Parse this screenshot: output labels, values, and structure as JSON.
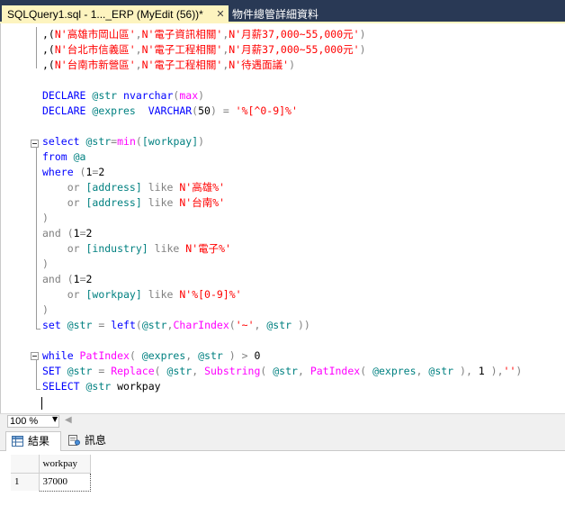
{
  "tabs": {
    "active_label": "SQLQuery1.sql - 1..._ERP (MyEdit (56))*",
    "close_glyph": "✕",
    "inactive_label": "物件總管詳細資料"
  },
  "code_lines": [
    [
      {
        "t": ",(",
        "c": "txt"
      },
      {
        "t": "N'高雄市岡山區'",
        "c": "str"
      },
      {
        "t": ",",
        "c": "op"
      },
      {
        "t": "N'電子資訊相關'",
        "c": "str"
      },
      {
        "t": ",",
        "c": "op"
      },
      {
        "t": "N'月薪37,000~55,000元'",
        "c": "str"
      },
      {
        "t": ")",
        "c": "op"
      }
    ],
    [
      {
        "t": ",(",
        "c": "txt"
      },
      {
        "t": "N'台北市信義區'",
        "c": "str"
      },
      {
        "t": ",",
        "c": "op"
      },
      {
        "t": "N'電子工程相關'",
        "c": "str"
      },
      {
        "t": ",",
        "c": "op"
      },
      {
        "t": "N'月薪37,000~55,000元'",
        "c": "str"
      },
      {
        "t": ")",
        "c": "op"
      }
    ],
    [
      {
        "t": ",(",
        "c": "txt"
      },
      {
        "t": "N'台南市新營區'",
        "c": "str"
      },
      {
        "t": ",",
        "c": "op"
      },
      {
        "t": "N'電子工程相關'",
        "c": "str"
      },
      {
        "t": ",",
        "c": "op"
      },
      {
        "t": "N'待遇面議'",
        "c": "str"
      },
      {
        "t": ")",
        "c": "op"
      }
    ],
    [],
    [
      {
        "t": "DECLARE ",
        "c": "kw"
      },
      {
        "t": "@str ",
        "c": "ident"
      },
      {
        "t": "nvarchar",
        "c": "kw"
      },
      {
        "t": "(",
        "c": "op"
      },
      {
        "t": "max",
        "c": "fn"
      },
      {
        "t": ")",
        "c": "op"
      }
    ],
    [
      {
        "t": "DECLARE ",
        "c": "kw"
      },
      {
        "t": "@expres  ",
        "c": "ident"
      },
      {
        "t": "VARCHAR",
        "c": "kw"
      },
      {
        "t": "(",
        "c": "op"
      },
      {
        "t": "50",
        "c": "txt"
      },
      {
        "t": ") = ",
        "c": "op"
      },
      {
        "t": "'%[^0-9]%'",
        "c": "str"
      }
    ],
    [],
    [
      {
        "t": "select ",
        "c": "kw"
      },
      {
        "t": "@str",
        "c": "ident"
      },
      {
        "t": "=",
        "c": "op"
      },
      {
        "t": "min",
        "c": "fn"
      },
      {
        "t": "(",
        "c": "op"
      },
      {
        "t": "[workpay]",
        "c": "ident"
      },
      {
        "t": ")",
        "c": "op"
      }
    ],
    [
      {
        "t": "from ",
        "c": "kw"
      },
      {
        "t": "@a",
        "c": "ident"
      }
    ],
    [
      {
        "t": "where ",
        "c": "kw"
      },
      {
        "t": "(",
        "c": "op"
      },
      {
        "t": "1",
        "c": "txt"
      },
      {
        "t": "=",
        "c": "op"
      },
      {
        "t": "2",
        "c": "txt"
      }
    ],
    [
      {
        "t": "    or ",
        "c": "op"
      },
      {
        "t": "[address] ",
        "c": "ident"
      },
      {
        "t": "like ",
        "c": "op"
      },
      {
        "t": "N'高雄%'",
        "c": "str"
      }
    ],
    [
      {
        "t": "    or ",
        "c": "op"
      },
      {
        "t": "[address] ",
        "c": "ident"
      },
      {
        "t": "like ",
        "c": "op"
      },
      {
        "t": "N'台南%'",
        "c": "str"
      }
    ],
    [
      {
        "t": ")",
        "c": "op"
      }
    ],
    [
      {
        "t": "and ",
        "c": "op"
      },
      {
        "t": "(",
        "c": "op"
      },
      {
        "t": "1",
        "c": "txt"
      },
      {
        "t": "=",
        "c": "op"
      },
      {
        "t": "2",
        "c": "txt"
      }
    ],
    [
      {
        "t": "    or ",
        "c": "op"
      },
      {
        "t": "[industry] ",
        "c": "ident"
      },
      {
        "t": "like ",
        "c": "op"
      },
      {
        "t": "N'電子%'",
        "c": "str"
      }
    ],
    [
      {
        "t": ")",
        "c": "op"
      }
    ],
    [
      {
        "t": "and ",
        "c": "op"
      },
      {
        "t": "(",
        "c": "op"
      },
      {
        "t": "1",
        "c": "txt"
      },
      {
        "t": "=",
        "c": "op"
      },
      {
        "t": "2",
        "c": "txt"
      }
    ],
    [
      {
        "t": "    or ",
        "c": "op"
      },
      {
        "t": "[workpay] ",
        "c": "ident"
      },
      {
        "t": "like ",
        "c": "op"
      },
      {
        "t": "N'%[0-9]%'",
        "c": "str"
      }
    ],
    [
      {
        "t": ")",
        "c": "op"
      }
    ],
    [
      {
        "t": "set ",
        "c": "kw"
      },
      {
        "t": "@str ",
        "c": "ident"
      },
      {
        "t": "= ",
        "c": "op"
      },
      {
        "t": "left",
        "c": "kw"
      },
      {
        "t": "(",
        "c": "op"
      },
      {
        "t": "@str",
        "c": "ident"
      },
      {
        "t": ",",
        "c": "op"
      },
      {
        "t": "CharIndex",
        "c": "fn"
      },
      {
        "t": "(",
        "c": "op"
      },
      {
        "t": "'~'",
        "c": "str"
      },
      {
        "t": ", ",
        "c": "op"
      },
      {
        "t": "@str ",
        "c": "ident"
      },
      {
        "t": "))",
        "c": "op"
      }
    ],
    [],
    [
      {
        "t": "while ",
        "c": "kw"
      },
      {
        "t": "PatIndex",
        "c": "fn"
      },
      {
        "t": "( ",
        "c": "op"
      },
      {
        "t": "@expres",
        "c": "ident"
      },
      {
        "t": ", ",
        "c": "op"
      },
      {
        "t": "@str ",
        "c": "ident"
      },
      {
        "t": ") > ",
        "c": "op"
      },
      {
        "t": "0",
        "c": "txt"
      }
    ],
    [
      {
        "t": "SET ",
        "c": "kw"
      },
      {
        "t": "@str ",
        "c": "ident"
      },
      {
        "t": "= ",
        "c": "op"
      },
      {
        "t": "Replace",
        "c": "fn"
      },
      {
        "t": "( ",
        "c": "op"
      },
      {
        "t": "@str",
        "c": "ident"
      },
      {
        "t": ", ",
        "c": "op"
      },
      {
        "t": "Substring",
        "c": "fn"
      },
      {
        "t": "( ",
        "c": "op"
      },
      {
        "t": "@str",
        "c": "ident"
      },
      {
        "t": ", ",
        "c": "op"
      },
      {
        "t": "PatIndex",
        "c": "fn"
      },
      {
        "t": "( ",
        "c": "op"
      },
      {
        "t": "@expres",
        "c": "ident"
      },
      {
        "t": ", ",
        "c": "op"
      },
      {
        "t": "@str ",
        "c": "ident"
      },
      {
        "t": "), ",
        "c": "op"
      },
      {
        "t": "1 ",
        "c": "txt"
      },
      {
        "t": "),",
        "c": "op"
      },
      {
        "t": "''",
        "c": "str"
      },
      {
        "t": ")",
        "c": "op"
      }
    ],
    [
      {
        "t": "SELECT ",
        "c": "kw"
      },
      {
        "t": "@str ",
        "c": "ident"
      },
      {
        "t": "workpay",
        "c": "txt"
      }
    ]
  ],
  "zoom": {
    "value": "100 %",
    "dropdown_icon": "chevron-down-icon",
    "scroll_icon": "scroll-left-icon"
  },
  "results_tabs": {
    "results_label": "結果",
    "messages_label": "訊息",
    "results_icon": "grid-icon",
    "messages_icon": "message-icon"
  },
  "grid": {
    "columns": [
      "workpay"
    ],
    "rows": [
      {
        "num": "1",
        "values": [
          "37000"
        ]
      }
    ]
  }
}
